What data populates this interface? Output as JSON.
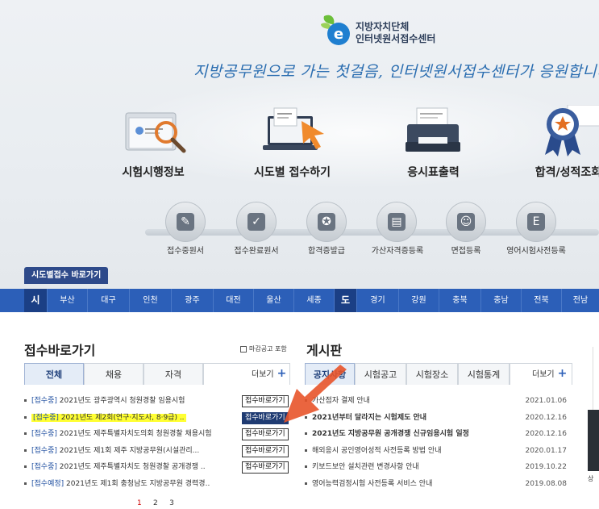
{
  "logo": {
    "line1": "지방자치단체",
    "line2": "인터넷원서접수센터"
  },
  "slogan": "지방공무원으로 가는 첫걸음, 인터넷원서접수센터가 응원합니다!",
  "features": [
    {
      "label": "시험시행정보"
    },
    {
      "label": "시도별 접수하기"
    },
    {
      "label": "응시표출력"
    },
    {
      "label": "합격/성적조회"
    }
  ],
  "quick_menu": [
    {
      "label": "접수중원서",
      "icon": "pencil-icon"
    },
    {
      "label": "접수완료원서",
      "icon": "checkbox-icon"
    },
    {
      "label": "합격증발급",
      "icon": "certificate-icon"
    },
    {
      "label": "가산자격증등록",
      "icon": "id-card-icon"
    },
    {
      "label": "면접등록",
      "icon": "profile-card-icon"
    },
    {
      "label": "영어시험사전등록",
      "icon": "english-doc-icon"
    }
  ],
  "shortcut_tab": "시도별접수 바로가기",
  "regions": [
    "시",
    "부산",
    "대구",
    "인천",
    "광주",
    "대전",
    "울산",
    "세종",
    "도",
    "경기",
    "강원",
    "충북",
    "충남",
    "전북",
    "전남"
  ],
  "left_section": {
    "title": "접수바로가기",
    "deadline_label": "마감공고 포함",
    "tabs": [
      "전체",
      "채용",
      "자격"
    ],
    "more_label": "더보기",
    "rows": [
      {
        "status": "[접수중]",
        "text": "2021년도 광주광역시 청원경찰 임용시험",
        "button": "접수바로가기"
      },
      {
        "status": "[접수중]",
        "text": "2021년도 제2회(연구·지도사, 8·9급) ..",
        "button": "접수바로가기"
      },
      {
        "status": "[접수중]",
        "text": "2021년도 제주특별자치도의회 청원경찰 채용시험",
        "button": "접수바로가기"
      },
      {
        "status": "[접수중]",
        "text": "2021년도 제1회 제주 지방공무원(시설관리...",
        "button": "접수바로가기"
      },
      {
        "status": "[접수중]",
        "text": "2021년도 제주특별자치도 청원경찰 공개경쟁 ..",
        "button": "접수바로가기"
      },
      {
        "status": "[접수예정]",
        "text": "2021년도 제1회 충청남도 지방공무원 경력경..",
        "button": ""
      }
    ],
    "pager": [
      "1",
      "2",
      "3"
    ]
  },
  "right_section": {
    "title": "게시판",
    "tabs": [
      "공지사항",
      "시험공고",
      "시험장소",
      "시험통계"
    ],
    "more_label": "더보기",
    "rows": [
      {
        "text": "가산점자 결제 안내",
        "date": "2021.01.06"
      },
      {
        "text": "2021년부터 달라지는 시험제도 안내",
        "date": "2020.12.16"
      },
      {
        "text": "2021년도 지방공무원 공개경쟁 신규임용시험 일정",
        "date": "2020.12.16"
      },
      {
        "text": "해외응시 공인영어성적 사전등록 방법 안내",
        "date": "2020.01.17"
      },
      {
        "text": "키보드보안 설치관련 변경사항 안내",
        "date": "2019.10.22"
      },
      {
        "text": "영어능력검정시험 사전등록 서비스 안내",
        "date": "2019.08.08"
      }
    ]
  },
  "side_label": "상",
  "colors": {
    "nav_blue": "#2c5fb8",
    "dark_blue": "#1b3f85",
    "highlight": "#ffff33",
    "arrow": "#e8542a"
  }
}
